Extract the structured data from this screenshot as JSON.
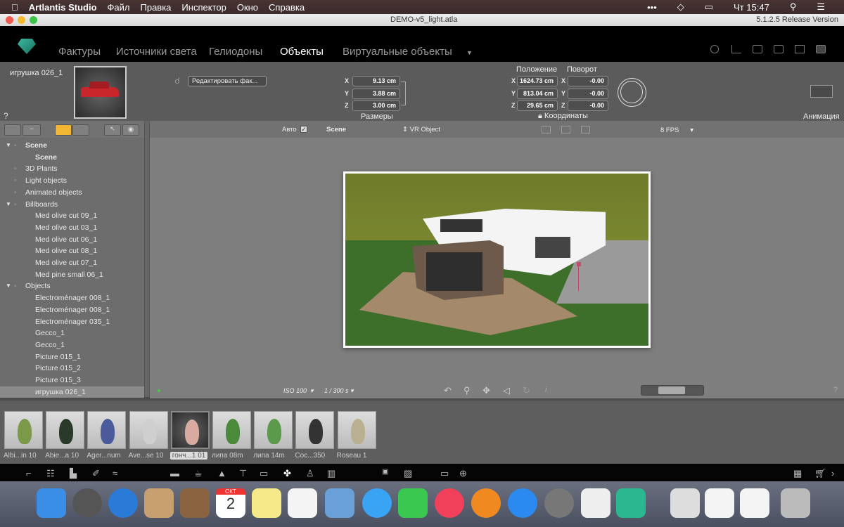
{
  "menubar": {
    "app": "Artlantis Studio",
    "items": [
      "Файл",
      "Правка",
      "Инспектор",
      "Окно",
      "Справка"
    ],
    "clock": "Чт 15:47"
  },
  "window": {
    "title": "DEMO-v5_light.atla",
    "version": "5.1.2.5 Release Version"
  },
  "tabs": [
    {
      "label": "Фактуры"
    },
    {
      "label": "Источники света"
    },
    {
      "label": "Гелиодоны"
    },
    {
      "label": "Объекты",
      "active": true
    },
    {
      "label": "Виртуальные объекты"
    }
  ],
  "inspector": {
    "object_name": "игрушка 026_1",
    "edit_dropdown": "Редактировать фак...",
    "size": {
      "label": "Размеры",
      "x": "9.13 cm",
      "y": "3.88 cm",
      "z": "3.00 cm"
    },
    "position": {
      "label": "Положение",
      "x": "1624.73 cm",
      "y": "813.04 cm",
      "z": "29.65 cm"
    },
    "rotation": {
      "label": "Поворот",
      "x": "-0.00",
      "y": "-0.00",
      "z": "-0.00"
    },
    "coords_label": "Координаты",
    "animation_label": "Анимация",
    "help": "?",
    "axis": {
      "x": "X",
      "y": "Y",
      "z": "Z"
    }
  },
  "viewbar": {
    "auto_label": "Авто",
    "auto_checked": true,
    "scene": "Scene",
    "mode": "VR Object",
    "fps": "8 FPS"
  },
  "tree": {
    "items": [
      {
        "label": "Scene",
        "level": 0,
        "group": true
      },
      {
        "label": "Scene",
        "level": 1,
        "bold": true
      },
      {
        "label": "3D Plants",
        "level": 0
      },
      {
        "label": "Light objects",
        "level": 0
      },
      {
        "label": "Animated objects",
        "level": 0
      },
      {
        "label": "Billboards",
        "level": 0,
        "group": true
      },
      {
        "label": "Med olive cut 09_1",
        "level": 1
      },
      {
        "label": "Med olive cut 03_1",
        "level": 1
      },
      {
        "label": "Med olive cut 06_1",
        "level": 1
      },
      {
        "label": "Med olive cut 08_1",
        "level": 1
      },
      {
        "label": "Med olive cut 07_1",
        "level": 1
      },
      {
        "label": "Med pine small 06_1",
        "level": 1
      },
      {
        "label": "Objects",
        "level": 0,
        "group": true
      },
      {
        "label": "Electroménager 008_1",
        "level": 1
      },
      {
        "label": "Electroménager 008_1",
        "level": 1
      },
      {
        "label": "Electroménager 035_1",
        "level": 1
      },
      {
        "label": "Gecco_1",
        "level": 1
      },
      {
        "label": "Gecco_1",
        "level": 1
      },
      {
        "label": "Picture 015_1",
        "level": 1
      },
      {
        "label": "Picture 015_2",
        "level": 1
      },
      {
        "label": "Picture 015_3",
        "level": 1
      },
      {
        "label": "игрушка 026_1",
        "level": 1,
        "selected": true
      }
    ]
  },
  "camera": {
    "iso": "ISO 100",
    "shutter": "1 / 300 s",
    "help": "?"
  },
  "catalog": [
    {
      "label": "Albi...in 10"
    },
    {
      "label": "Abie...a 10"
    },
    {
      "label": "Ager...num"
    },
    {
      "label": "Ave...se 10"
    },
    {
      "label": "гонч...1 01",
      "selected": true
    },
    {
      "label": "липа 08m"
    },
    {
      "label": "липа 14m"
    },
    {
      "label": "Coc...350"
    },
    {
      "label": "Roseau 1"
    }
  ],
  "dock": [
    "finder",
    "launchpad",
    "safari",
    "mail",
    "contacts",
    "calendar",
    "notes",
    "reminders",
    "preview",
    "messages",
    "facetime",
    "music",
    "books",
    "app-store",
    "system-preferences",
    "textedit",
    "artlantis",
    "archive",
    "document",
    "document",
    "trash"
  ],
  "calendar": {
    "month": "ОКТ",
    "day": "2"
  },
  "colors": {
    "accent": "#f2b632",
    "selected_row": "#8a8a8a"
  }
}
